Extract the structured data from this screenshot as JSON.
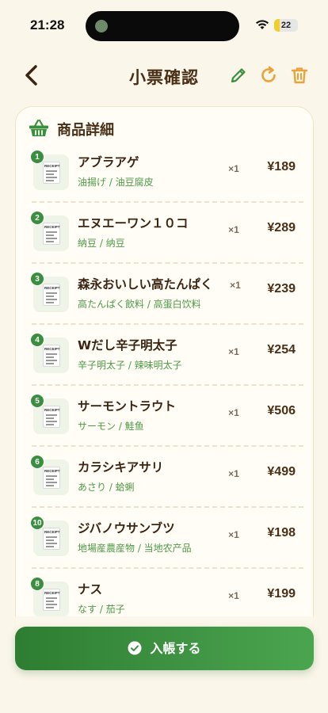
{
  "status_bar": {
    "time": "21:28",
    "battery_level": "22",
    "battery_fraction": 0.22
  },
  "header": {
    "title": "小票確認",
    "back_icon": "chevron-left-icon",
    "edit_icon": "pencil-icon",
    "refresh_icon": "refresh-icon",
    "delete_icon": "trash-icon"
  },
  "card": {
    "title": "商品詳細",
    "icon": "basket-icon",
    "items": [
      {
        "index": "1",
        "name": "アブラアゲ",
        "sub": "油揚げ / 油豆腐皮",
        "qty": "×1",
        "price": "¥189"
      },
      {
        "index": "2",
        "name": "エヌエーワン１０コ",
        "sub": "納豆 / 纳豆",
        "qty": "×1",
        "price": "¥289"
      },
      {
        "index": "3",
        "name": "森永おいしい高たんぱく",
        "sub": "高たんぱく飲料 / 高蛋白饮料",
        "qty": "×1",
        "price": "¥239"
      },
      {
        "index": "4",
        "name": "Wだし辛子明太子",
        "sub": "辛子明太子 / 辣味明太子",
        "qty": "×1",
        "price": "¥254"
      },
      {
        "index": "5",
        "name": "サーモントラウト",
        "sub": "サーモン / 鮭鱼",
        "qty": "×1",
        "price": "¥506"
      },
      {
        "index": "6",
        "name": "カラシキアサリ",
        "sub": "あさり / 蛤蜊",
        "qty": "×1",
        "price": "¥499"
      },
      {
        "index": "10",
        "name": "ジバノウサンブツ",
        "sub": "地場産農産物 / 当地农产品",
        "qty": "×1",
        "price": "¥198"
      },
      {
        "index": "8",
        "name": "ナス",
        "sub": "なす / 茄子",
        "qty": "×1",
        "price": "¥199"
      }
    ]
  },
  "confirm_button": {
    "label": "入帳する",
    "icon": "check-circle-icon"
  },
  "colors": {
    "accent_green": "#3a8f3f",
    "accent_orange": "#e8a33a",
    "background": "#fbf6ea",
    "text_brown": "#4a2f17"
  }
}
